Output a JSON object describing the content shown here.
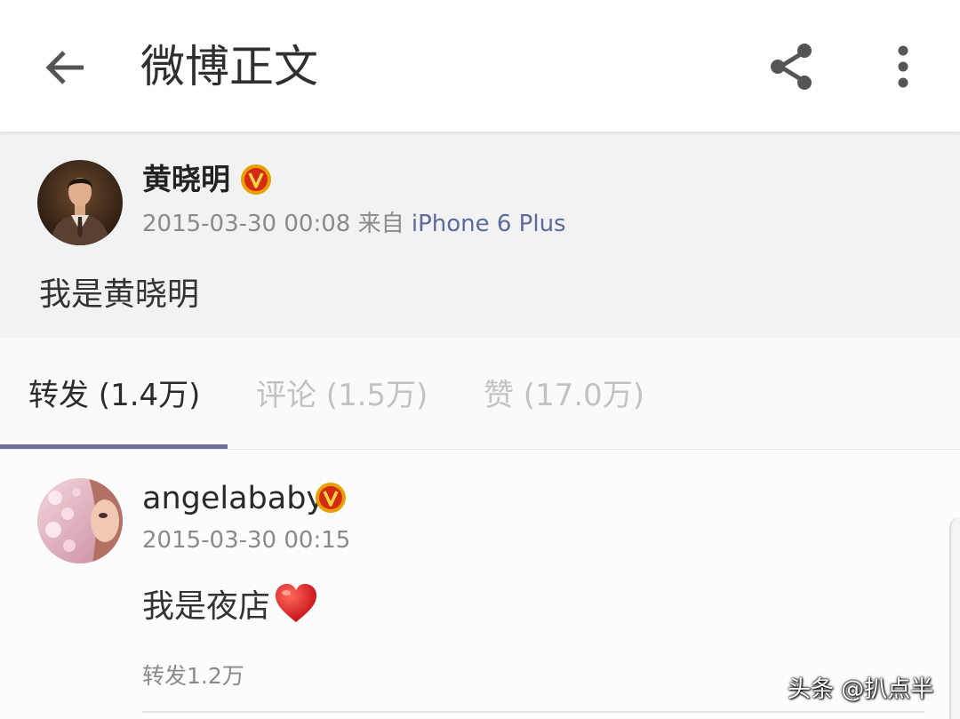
{
  "header": {
    "title": "微博正文",
    "back_icon": "arrow-left-icon",
    "share_icon": "share-icon",
    "more_icon": "more-vertical-icon"
  },
  "post": {
    "username": "黄晓明",
    "verified_badge": "V",
    "time": "2015-03-30 00:08",
    "source_prefix": "来自",
    "source": "iPhone 6 Plus",
    "text": "我是黄晓明"
  },
  "tabs": [
    {
      "label": "转发 (1.4万)",
      "active": true
    },
    {
      "label": "评论 (1.5万)",
      "active": false
    },
    {
      "label": "赞 (17.0万)",
      "active": false
    }
  ],
  "reposts": [
    {
      "username": "angelababy",
      "verified_badge": "V",
      "time": "2015-03-30 00:15",
      "text": "我是夜店",
      "emoji": "heart-emoji-icon",
      "repost_count": "转发1.2万"
    }
  ],
  "watermark": "头条 @扒点半",
  "colors": {
    "accent": "#6b6f9c",
    "source_link": "#5c6a9c",
    "badge": "#e8a000",
    "badge_inner": "#d42a12"
  }
}
